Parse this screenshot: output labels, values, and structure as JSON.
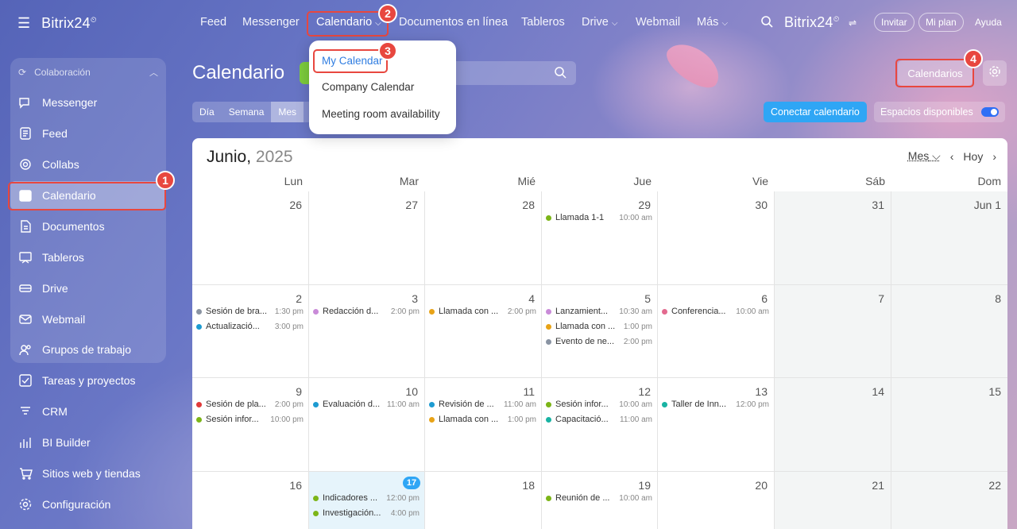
{
  "colors": {
    "highlight": "#e8473f",
    "accent": "#2fa6f5",
    "green": "#7ccc3c"
  },
  "brand": {
    "name": "Bitrix24",
    "mark": "⏲"
  },
  "sidebar": {
    "group_label": "Colaboración",
    "items": [
      {
        "label": "Messenger",
        "icon": "chat-icon"
      },
      {
        "label": "Feed",
        "icon": "feed-icon"
      },
      {
        "label": "Collabs",
        "icon": "collabs-icon"
      },
      {
        "label": "Calendario",
        "icon": "calendar-icon"
      },
      {
        "label": "Documentos",
        "icon": "document-icon"
      },
      {
        "label": "Tableros",
        "icon": "board-icon"
      },
      {
        "label": "Drive",
        "icon": "drive-icon"
      },
      {
        "label": "Webmail",
        "icon": "mail-icon"
      },
      {
        "label": "Grupos de trabajo",
        "icon": "group-icon"
      },
      {
        "label": "Tareas y proyectos",
        "icon": "tasks-icon"
      },
      {
        "label": "CRM",
        "icon": "crm-icon"
      },
      {
        "label": "BI Builder",
        "icon": "bi-icon"
      },
      {
        "label": "Sitios web y tiendas",
        "icon": "cart-icon"
      },
      {
        "label": "Configuración",
        "icon": "gear-icon"
      }
    ]
  },
  "topnav": {
    "feed": "Feed",
    "messenger": "Messenger",
    "calendario": "Calendario",
    "documentos": "Documentos en línea",
    "tableros": "Tableros",
    "drive": "Drive",
    "webmail": "Webmail",
    "mas": "Más",
    "invitar": "Invitar",
    "mi_plan": "Mi plan",
    "ayuda": "Ayuda"
  },
  "dropdown": {
    "items": [
      "My Calendar",
      "Company Calendar",
      "Meeting room availability"
    ]
  },
  "callouts": [
    "1",
    "2",
    "3",
    "4"
  ],
  "header": {
    "title": "Calendario",
    "calendars_button": "Calendarios",
    "connect_button": "Conectar calendario",
    "available_spaces": "Espacios disponibles"
  },
  "view_tabs": [
    "Día",
    "Semana",
    "Mes"
  ],
  "calendar": {
    "month": "Junio,",
    "year": "2025",
    "view_select": "Mes",
    "today_label": "Hoy",
    "days_of_week": [
      "Lun",
      "Mar",
      "Mié",
      "Jue",
      "Vie",
      "Sáb",
      "Dom"
    ],
    "weeks": [
      {
        "days": [
          {
            "num": "26",
            "events": []
          },
          {
            "num": "27",
            "events": []
          },
          {
            "num": "28",
            "events": []
          },
          {
            "num": "29",
            "events": [
              {
                "title": "Llamada 1-1",
                "time": "10:00 am",
                "color": "#7cb518"
              }
            ]
          },
          {
            "num": "30",
            "events": []
          },
          {
            "num": "31",
            "events": []
          },
          {
            "num": "Jun 1",
            "events": []
          }
        ]
      },
      {
        "days": [
          {
            "num": "2",
            "events": [
              {
                "title": "Sesión de bra...",
                "time": "1:30 pm",
                "color": "#8a94a3"
              },
              {
                "title": "Actualizació...",
                "time": "3:00 pm",
                "color": "#1d9bd1"
              }
            ]
          },
          {
            "num": "3",
            "events": [
              {
                "title": "Redacción d...",
                "time": "2:00 pm",
                "color": "#c98bd8"
              }
            ]
          },
          {
            "num": "4",
            "events": [
              {
                "title": "Llamada con ...",
                "time": "2:00 pm",
                "color": "#e8a317"
              }
            ]
          },
          {
            "num": "5",
            "events": [
              {
                "title": "Lanzamient...",
                "time": "10:30 am",
                "color": "#c98bd8"
              },
              {
                "title": "Llamada con ...",
                "time": "1:00 pm",
                "color": "#e8a317"
              },
              {
                "title": "Evento de ne...",
                "time": "2:00 pm",
                "color": "#8a94a3"
              }
            ]
          },
          {
            "num": "6",
            "events": [
              {
                "title": "Conferencia...",
                "time": "10:00 am",
                "color": "#e36a8f"
              }
            ]
          },
          {
            "num": "7",
            "events": []
          },
          {
            "num": "8",
            "events": []
          }
        ]
      },
      {
        "days": [
          {
            "num": "9",
            "events": [
              {
                "title": "Sesión de pla...",
                "time": "2:00 pm",
                "color": "#e03a3a"
              },
              {
                "title": "Sesión infor...",
                "time": "10:00 pm",
                "color": "#7cb518"
              }
            ]
          },
          {
            "num": "10",
            "events": [
              {
                "title": "Evaluación d...",
                "time": "11:00 am",
                "color": "#1d9bd1"
              }
            ]
          },
          {
            "num": "11",
            "events": [
              {
                "title": "Revisión de ...",
                "time": "11:00 am",
                "color": "#1d9bd1"
              },
              {
                "title": "Llamada con ...",
                "time": "1:00 pm",
                "color": "#e8a317"
              }
            ]
          },
          {
            "num": "12",
            "events": [
              {
                "title": "Sesión infor...",
                "time": "10:00 am",
                "color": "#7cb518"
              },
              {
                "title": "Capacitació...",
                "time": "11:00 am",
                "color": "#19b3a3"
              }
            ]
          },
          {
            "num": "13",
            "events": [
              {
                "title": "Taller de Inn...",
                "time": "12:00 pm",
                "color": "#19b3a3"
              }
            ]
          },
          {
            "num": "14",
            "events": []
          },
          {
            "num": "15",
            "events": []
          }
        ]
      },
      {
        "days": [
          {
            "num": "16",
            "events": []
          },
          {
            "num": "17",
            "events": [
              {
                "title": "Indicadores ...",
                "time": "12:00 pm",
                "color": "#7cb518"
              },
              {
                "title": "Investigación...",
                "time": "4:00 pm",
                "color": "#7cb518"
              }
            ]
          },
          {
            "num": "18",
            "events": []
          },
          {
            "num": "19",
            "events": [
              {
                "title": "Reunión de ...",
                "time": "10:00 am",
                "color": "#7cb518"
              }
            ]
          },
          {
            "num": "20",
            "events": []
          },
          {
            "num": "21",
            "events": []
          },
          {
            "num": "22",
            "events": []
          }
        ]
      }
    ]
  }
}
